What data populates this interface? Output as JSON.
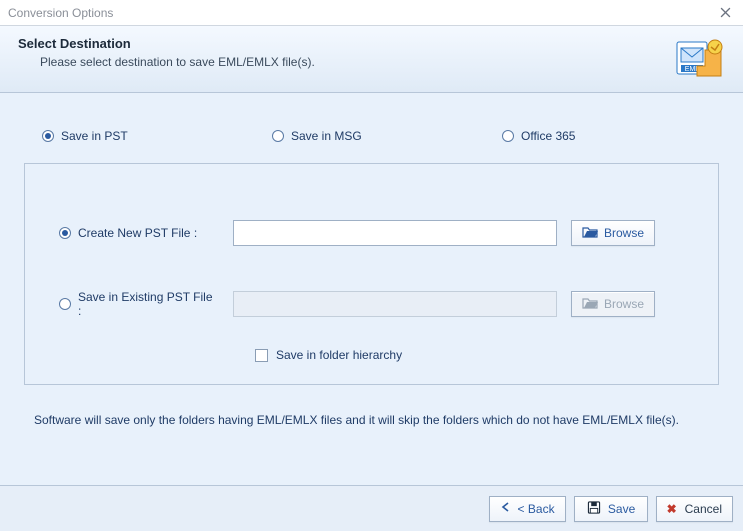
{
  "window": {
    "title": "Conversion Options"
  },
  "header": {
    "title": "Select Destination",
    "subtitle": "Please select destination to save EML/EMLX file(s)."
  },
  "format_options": {
    "pst": "Save in PST",
    "msg": "Save in MSG",
    "o365": "Office 365",
    "selected": "pst"
  },
  "pst_panel": {
    "create_new_label": "Create New PST File :",
    "existing_label": "Save in Existing PST File :",
    "selected": "create_new",
    "create_new_value": "",
    "existing_value": "",
    "browse_label": "Browse",
    "hierarchy_label": "Save in folder hierarchy",
    "hierarchy_checked": false
  },
  "note": "Software will save only the folders having EML/EMLX files and it will skip the folders which do not have EML/EMLX file(s).",
  "footer": {
    "back": "Back",
    "save": "Save",
    "cancel": "Cancel"
  }
}
